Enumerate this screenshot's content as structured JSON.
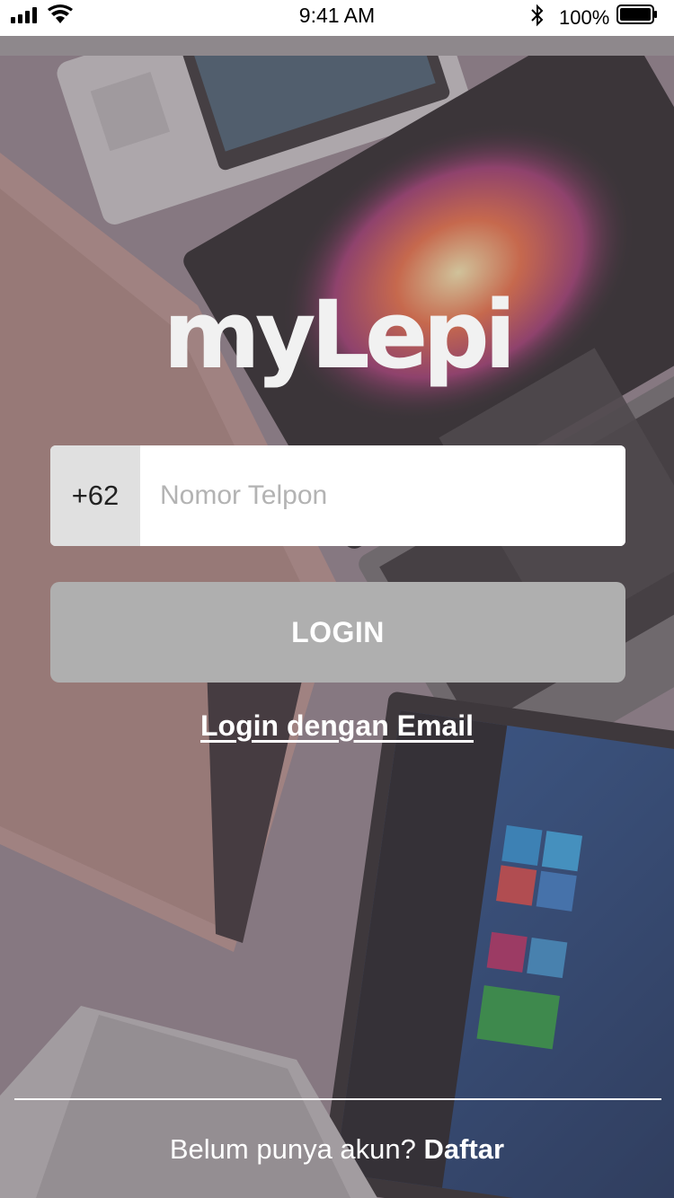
{
  "status_bar": {
    "time": "9:41 AM",
    "battery_percent": "100%",
    "icons": [
      "signal-icon",
      "wifi-icon",
      "bluetooth-icon",
      "battery-icon"
    ]
  },
  "app": {
    "logo": "myLepi"
  },
  "login_form": {
    "country_code": "+62",
    "phone_placeholder": "Nomor Telpon",
    "phone_value": "",
    "login_button": "LOGIN",
    "email_link": "Login dengan Email"
  },
  "footer": {
    "prompt": "Belum punya akun?",
    "register_link": "Daftar"
  },
  "colors": {
    "button_disabled": "#afafaf",
    "country_code_bg": "#e0e0e0",
    "text_on_dark": "#ffffff",
    "background_tint": "#8b7f88"
  }
}
